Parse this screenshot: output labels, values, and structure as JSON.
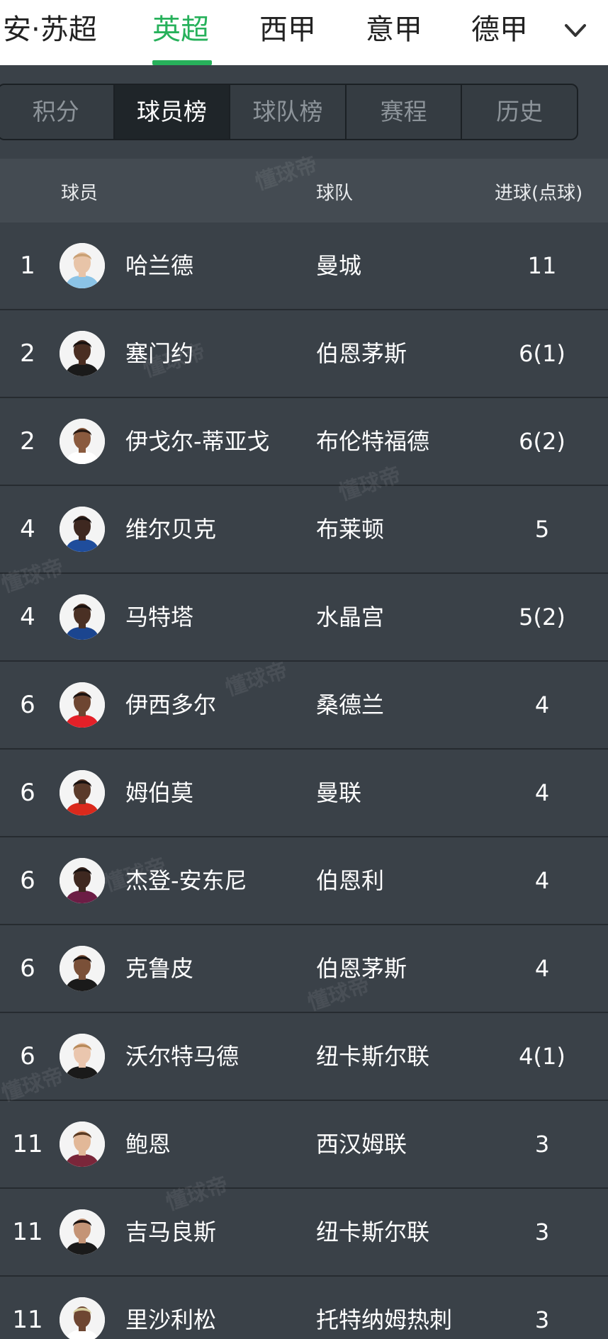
{
  "leagues": [
    {
      "label": "安·苏超",
      "active": false
    },
    {
      "label": "英超",
      "active": true
    },
    {
      "label": "西甲",
      "active": false
    },
    {
      "label": "意甲",
      "active": false
    },
    {
      "label": "德甲",
      "active": false
    }
  ],
  "sub_tabs": [
    {
      "label": "积分",
      "active": false
    },
    {
      "label": "球员榜",
      "active": true
    },
    {
      "label": "球队榜",
      "active": false
    },
    {
      "label": "赛程",
      "active": false
    },
    {
      "label": "历史",
      "active": false
    }
  ],
  "table": {
    "columns": {
      "player": "球员",
      "team": "球队",
      "goals": "进球(点球)"
    },
    "rows": [
      {
        "rank": "1",
        "player": "哈兰德",
        "team": "曼城",
        "goals": "11",
        "avatar": {
          "skin": "#e8c4a8",
          "hair": "#c9a074",
          "shirt": "#8bc3e6"
        }
      },
      {
        "rank": "2",
        "player": "塞门约",
        "team": "伯恩茅斯",
        "goals": "6(1)",
        "avatar": {
          "skin": "#4a2e22",
          "hair": "#1a1210",
          "shirt": "#1a1a1a"
        }
      },
      {
        "rank": "2",
        "player": "伊戈尔-蒂亚戈",
        "team": "布伦特福德",
        "goals": "6(2)",
        "avatar": {
          "skin": "#8a5a3e",
          "hair": "#2a1a12",
          "shirt": "#ffffff"
        }
      },
      {
        "rank": "4",
        "player": "维尔贝克",
        "team": "布莱顿",
        "goals": "5",
        "avatar": {
          "skin": "#3e2820",
          "hair": "#1a1210",
          "shirt": "#1f4d9c"
        }
      },
      {
        "rank": "4",
        "player": "马特塔",
        "team": "水晶宫",
        "goals": "5(2)",
        "avatar": {
          "skin": "#4a3024",
          "hair": "#1a1210",
          "shirt": "#1b458f"
        }
      },
      {
        "rank": "6",
        "player": "伊西多尔",
        "team": "桑德兰",
        "goals": "4",
        "avatar": {
          "skin": "#6e4632",
          "hair": "#1a1210",
          "shirt": "#e32028"
        }
      },
      {
        "rank": "6",
        "player": "姆伯莫",
        "team": "曼联",
        "goals": "4",
        "avatar": {
          "skin": "#5a3a2a",
          "hair": "#1a1210",
          "shirt": "#da291c"
        }
      },
      {
        "rank": "6",
        "player": "杰登-安东尼",
        "team": "伯恩利",
        "goals": "4",
        "avatar": {
          "skin": "#3e2820",
          "hair": "#1a1210",
          "shirt": "#6c1d45"
        }
      },
      {
        "rank": "6",
        "player": " 克鲁皮",
        "team": "伯恩茅斯",
        "goals": "4",
        "avatar": {
          "skin": "#7a5038",
          "hair": "#1a1210",
          "shirt": "#1a1a1a"
        }
      },
      {
        "rank": "6",
        "player": "沃尔特马德",
        "team": "纽卡斯尔联",
        "goals": "4(1)",
        "avatar": {
          "skin": "#eac6ae",
          "hair": "#b88a5a",
          "shirt": "#1a1a1a"
        }
      },
      {
        "rank": "11",
        "player": "鲍恩",
        "team": "西汉姆联",
        "goals": "3",
        "avatar": {
          "skin": "#e2b898",
          "hair": "#5a3a22",
          "shirt": "#7a263a"
        }
      },
      {
        "rank": "11",
        "player": "吉马良斯",
        "team": "纽卡斯尔联",
        "goals": "3",
        "avatar": {
          "skin": "#c49476",
          "hair": "#1a1210",
          "shirt": "#1a1a1a"
        }
      },
      {
        "rank": "11",
        "player": "里沙利松",
        "team": "托特纳姆热刺",
        "goals": "3",
        "avatar": {
          "skin": "#6e4632",
          "hair": "#d8d0a0",
          "shirt": "#ffffff"
        }
      }
    ]
  },
  "watermark": "懂球帝",
  "colors": {
    "accent": "#27b15b",
    "background": "#3a4148",
    "header_row": "#444b52"
  }
}
